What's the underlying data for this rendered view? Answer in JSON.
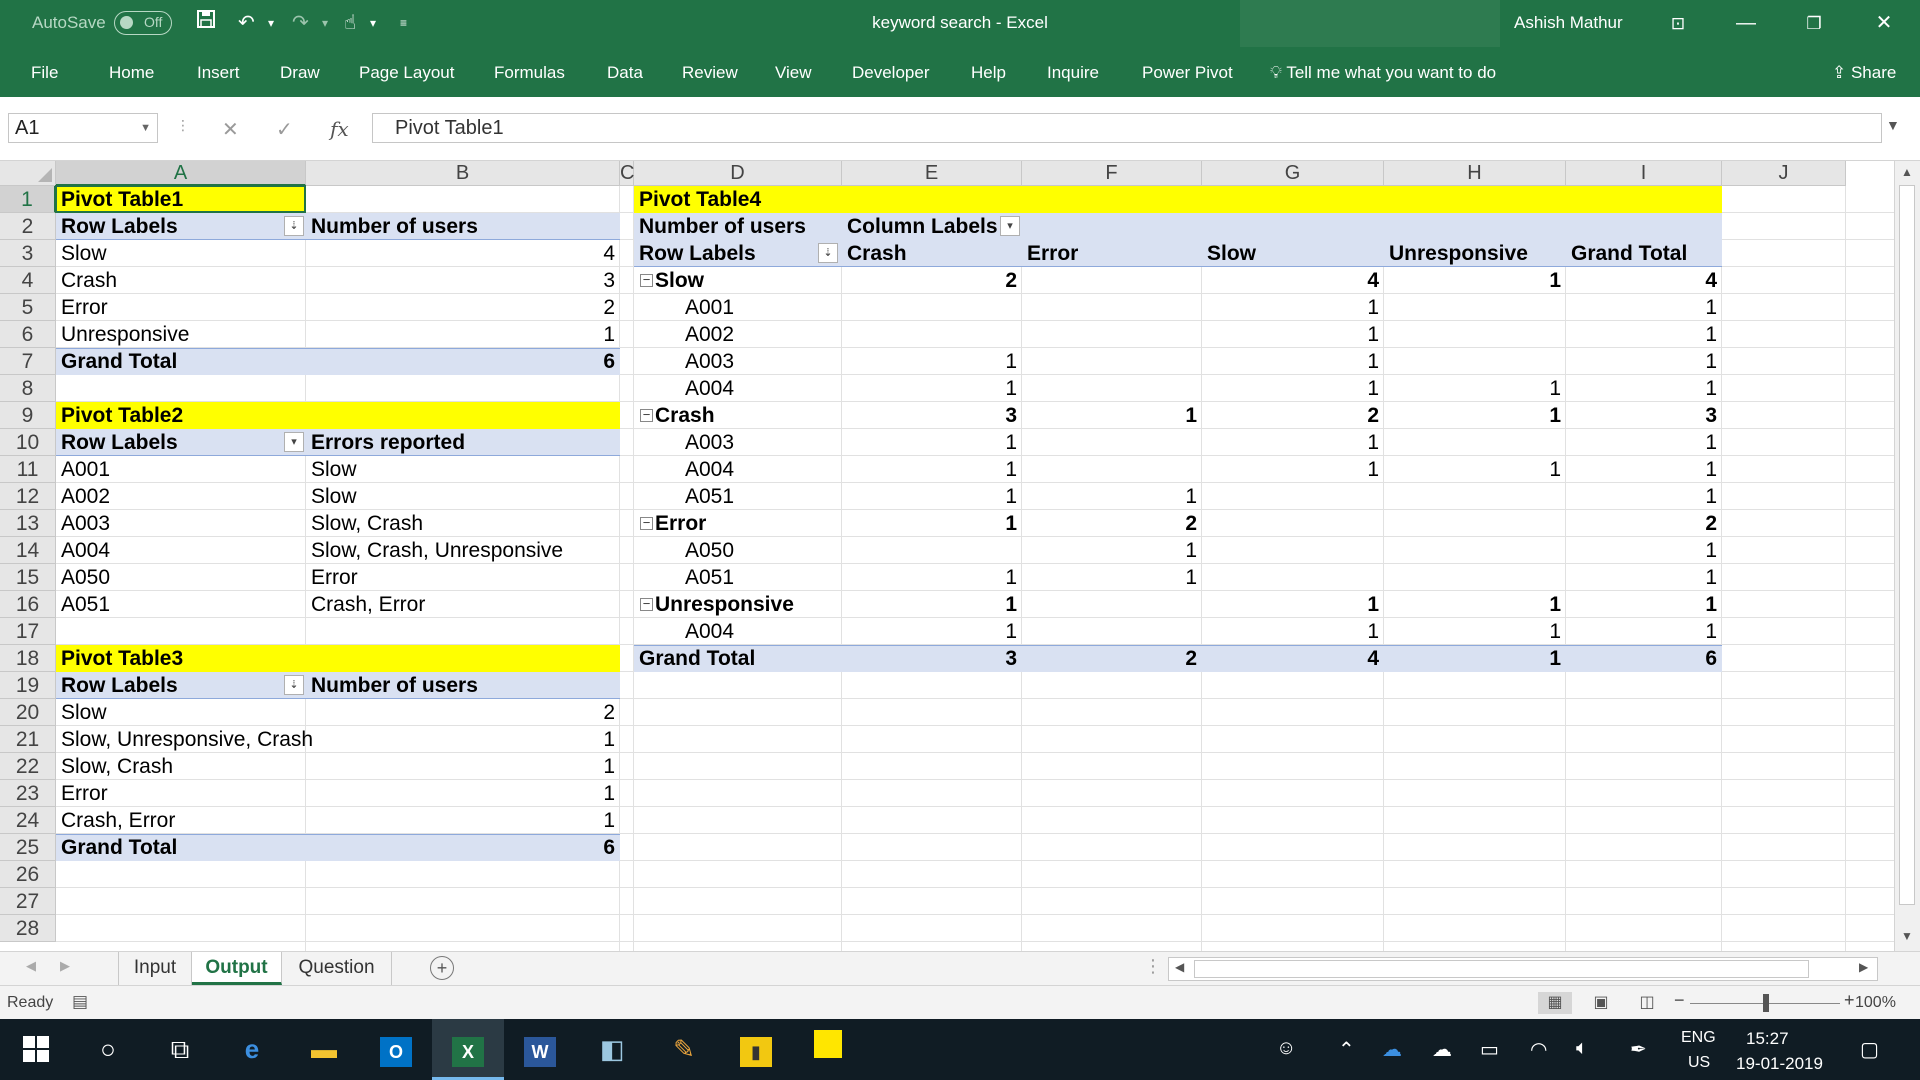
{
  "titlebar": {
    "autosave_label": "AutoSave",
    "autosave_state": "Off",
    "document_title": "keyword search  -  Excel",
    "user": "Ashish Mathur",
    "qat_save_icon": "save-icon",
    "qat_undo_icon": "undo-icon",
    "qat_redo_icon": "redo-icon",
    "qat_touch_icon": "touch-mode-icon"
  },
  "menu": {
    "items": [
      "File",
      "Home",
      "Insert",
      "Draw",
      "Page Layout",
      "Formulas",
      "Data",
      "Review",
      "View",
      "Developer",
      "Help",
      "Inquire",
      "Power Pivot"
    ],
    "tell_me": "Tell me what you want to do",
    "share": "Share"
  },
  "formula_bar": {
    "name_box": "A1",
    "formula": "Pivot Table1",
    "fx": "fx"
  },
  "columns": [
    "A",
    "B",
    "C",
    "D",
    "E",
    "F",
    "G",
    "H",
    "I",
    "J"
  ],
  "rows": [
    "1",
    "2",
    "3",
    "4",
    "5",
    "6",
    "7",
    "8",
    "9",
    "10",
    "11",
    "12",
    "13",
    "14",
    "15",
    "16",
    "17",
    "18",
    "19",
    "20",
    "21",
    "22",
    "23",
    "24",
    "25",
    "26",
    "27",
    "28"
  ],
  "pivot1": {
    "title": "Pivot Table1",
    "header_row_labels": "Row Labels",
    "header_value": "Number of users",
    "rows": [
      {
        "label": "Slow",
        "value": "4"
      },
      {
        "label": "Crash",
        "value": "3"
      },
      {
        "label": "Error",
        "value": "2"
      },
      {
        "label": "Unresponsive",
        "value": "1"
      }
    ],
    "grand_total_label": "Grand Total",
    "grand_total_value": "6"
  },
  "pivot2": {
    "title": "Pivot Table2",
    "header_row_labels": "Row Labels",
    "header_value": "Errors reported",
    "rows": [
      {
        "label": "A001",
        "value": "Slow"
      },
      {
        "label": "A002",
        "value": "Slow"
      },
      {
        "label": "A003",
        "value": "Slow, Crash"
      },
      {
        "label": "A004",
        "value": "Slow, Crash, Unresponsive"
      },
      {
        "label": "A050",
        "value": "Error"
      },
      {
        "label": "A051",
        "value": "Crash, Error"
      }
    ]
  },
  "pivot3": {
    "title": "Pivot Table3",
    "header_row_labels": "Row Labels",
    "header_value": "Number of users",
    "rows": [
      {
        "label": "Slow",
        "value": "2"
      },
      {
        "label": "Slow, Unresponsive, Crash",
        "value": "1"
      },
      {
        "label": "Slow, Crash",
        "value": "1"
      },
      {
        "label": "Error",
        "value": "1"
      },
      {
        "label": "Crash, Error",
        "value": "1"
      }
    ],
    "grand_total_label": "Grand Total",
    "grand_total_value": "6"
  },
  "pivot4": {
    "title": "Pivot Table4",
    "value_field": "Number of users",
    "column_labels": "Column Labels",
    "row_labels": "Row Labels",
    "col_headers": [
      "Crash",
      "Error",
      "Slow",
      "Unresponsive",
      "Grand Total"
    ],
    "rows": [
      {
        "label": "Slow",
        "group": true,
        "vals": [
          "2",
          "",
          "4",
          "1",
          "4"
        ]
      },
      {
        "label": "A001",
        "group": false,
        "vals": [
          "",
          "",
          "1",
          "",
          "1"
        ]
      },
      {
        "label": "A002",
        "group": false,
        "vals": [
          "",
          "",
          "1",
          "",
          "1"
        ]
      },
      {
        "label": "A003",
        "group": false,
        "vals": [
          "1",
          "",
          "1",
          "",
          "1"
        ]
      },
      {
        "label": "A004",
        "group": false,
        "vals": [
          "1",
          "",
          "1",
          "1",
          "1"
        ]
      },
      {
        "label": "Crash",
        "group": true,
        "vals": [
          "3",
          "1",
          "2",
          "1",
          "3"
        ]
      },
      {
        "label": "A003",
        "group": false,
        "vals": [
          "1",
          "",
          "1",
          "",
          "1"
        ]
      },
      {
        "label": "A004",
        "group": false,
        "vals": [
          "1",
          "",
          "1",
          "1",
          "1"
        ]
      },
      {
        "label": "A051",
        "group": false,
        "vals": [
          "1",
          "1",
          "",
          "",
          "1"
        ]
      },
      {
        "label": "Error",
        "group": true,
        "vals": [
          "1",
          "2",
          "",
          "",
          "2"
        ]
      },
      {
        "label": "A050",
        "group": false,
        "vals": [
          "",
          "1",
          "",
          "",
          "1"
        ]
      },
      {
        "label": "A051",
        "group": false,
        "vals": [
          "1",
          "1",
          "",
          "",
          "1"
        ]
      },
      {
        "label": "Unresponsive",
        "group": true,
        "vals": [
          "1",
          "",
          "1",
          "1",
          "1"
        ]
      },
      {
        "label": "A004",
        "group": false,
        "vals": [
          "1",
          "",
          "1",
          "1",
          "1"
        ]
      }
    ],
    "grand_total_label": "Grand Total",
    "grand_total_vals": [
      "3",
      "2",
      "4",
      "1",
      "6"
    ]
  },
  "sheet_tabs": [
    "Input",
    "Output",
    "Question"
  ],
  "active_tab": "Output",
  "status": {
    "ready": "Ready",
    "zoom": "100%"
  },
  "taskbar": {
    "lang_top": "ENG",
    "lang_bottom": "US",
    "time": "15:27",
    "date": "19-01-2019"
  },
  "colors": {
    "excel_green": "#217346",
    "highlight_yellow": "#ffff00",
    "pivot_header_blue": "#d9e1f2"
  }
}
